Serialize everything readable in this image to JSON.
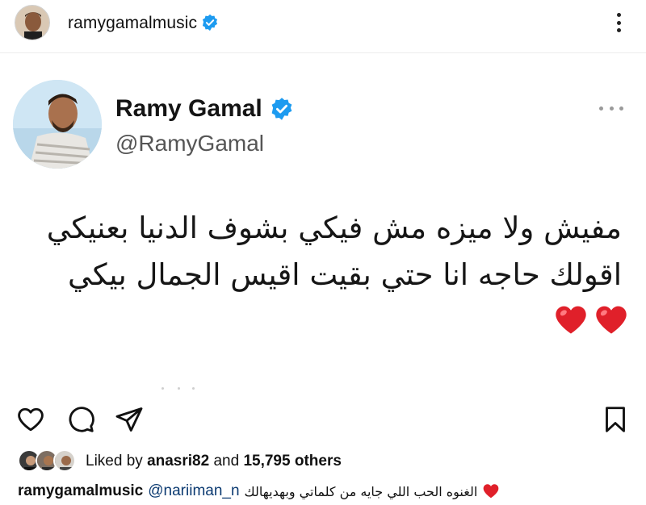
{
  "header": {
    "username": "ramygamalmusic",
    "verified_icon": "verified-badge-icon",
    "more_icon": "more-vertical-icon"
  },
  "tweet": {
    "name": "Ramy Gamal",
    "handle": "@RamyGamal",
    "lines": [
      "مفيش ولا ميزه مش فيكي بشوف الدنيا بعنيكي",
      "اقولك حاجه انا حتي بقيت اقيس الجمال بيكي"
    ],
    "hearts": 2,
    "accent": "#1d9bf0",
    "heart_color": "#e0202a"
  },
  "actions": {
    "like_icon": "heart-outline-icon",
    "comment_icon": "comment-icon",
    "share_icon": "send-icon",
    "save_icon": "bookmark-icon"
  },
  "likes": {
    "prefix": "Liked by",
    "user": "anasri82",
    "middle": "and",
    "count": "15,795 others"
  },
  "caption": {
    "user": "ramygamalmusic",
    "mention": "@nariiman_n",
    "text": "الغنوه الحب اللي جايه من كلماتي وبهديهالك"
  }
}
